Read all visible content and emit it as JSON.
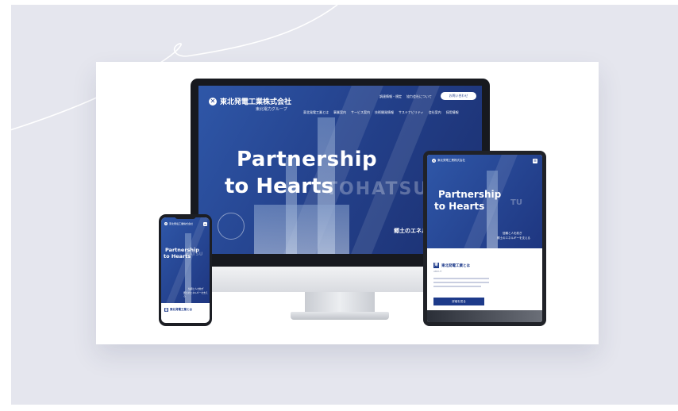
{
  "colors": {
    "brand_blue": "#1d3a8a",
    "background": "#e5e6ee",
    "device_bezel": "#17191f"
  },
  "desktop": {
    "company_name": "東北発電工業株式会社",
    "group_label": "東北電力グループ",
    "top_links": [
      "調達情報・規定",
      "協力会社について"
    ],
    "contact_button": "お問い合わせ",
    "nav": [
      "東北発電工業とは",
      "事業案内",
      "サービス案内",
      "技術開発情報",
      "サステナビリティ",
      "会社案内",
      "採用情報"
    ],
    "hero_line1": "Partnership",
    "hero_line2": "to Hearts",
    "watermark": "TOHATSU",
    "tagline": "郷土のエネルギ"
  },
  "tablet": {
    "company_name": "東北発電工業株式会社",
    "hero_line1": "Partnership",
    "hero_line2": "to Hearts",
    "watermark": "TU",
    "tagline_1": "信頼と人を紡ぎ",
    "tagline_2": "郷土のエネルギーを支える",
    "about_mark": "東",
    "about_title": "東北発電工業とは",
    "about_sub": "ABOUT",
    "about_button": "詳細を見る"
  },
  "phone": {
    "company_name": "東北発電工業株式会社",
    "hero_line1": "Partnership",
    "hero_line2": "to Hearts",
    "watermark": "HATSU",
    "tagline_1": "信頼と人を紡ぎ",
    "tagline_2": "郷土のエネルギーを支える",
    "about_mark": "東",
    "about_title": "東北発電工業とは"
  }
}
